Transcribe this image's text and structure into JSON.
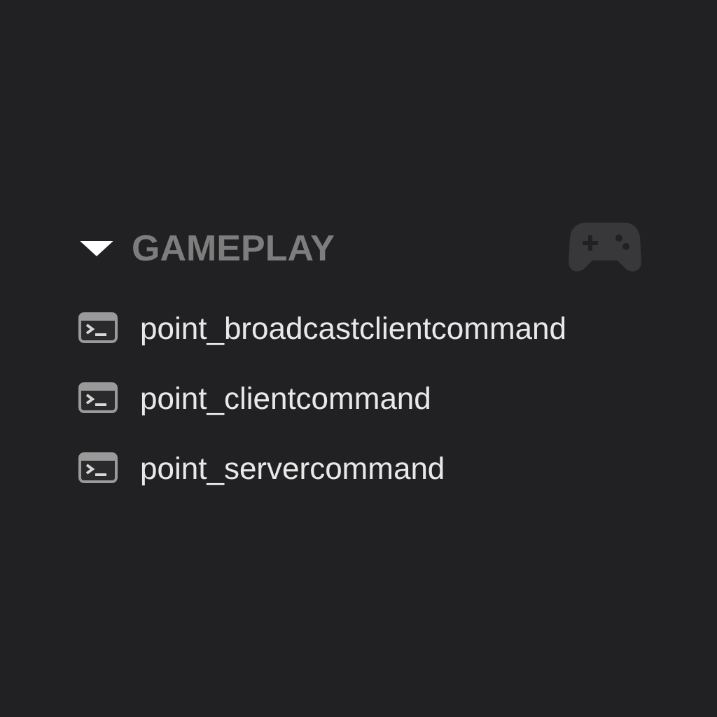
{
  "category": {
    "title": "GAMEPLAY",
    "expanded": true,
    "items": [
      {
        "label": "point_broadcastclientcommand"
      },
      {
        "label": "point_clientcommand"
      },
      {
        "label": "point_servercommand"
      }
    ]
  }
}
